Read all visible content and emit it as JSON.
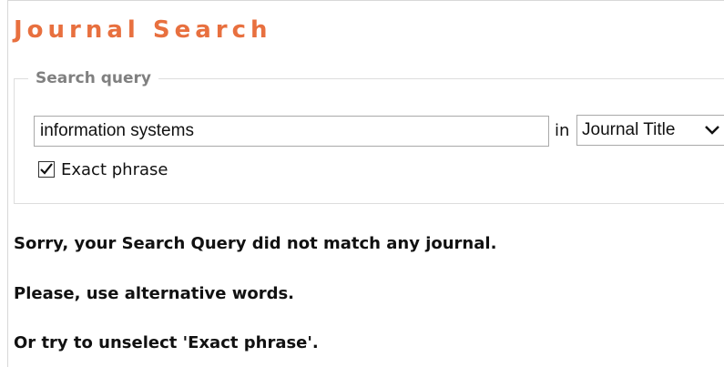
{
  "header": {
    "title": "Journal Search"
  },
  "search": {
    "legend": "Search query",
    "query_value": "information systems",
    "in_label": "in",
    "field_selected": "Journal Title",
    "exact_phrase_label": "Exact phrase",
    "exact_phrase_checked": true
  },
  "results": {
    "messages": [
      "Sorry, your Search Query did not match any journal.",
      "Please, use alternative words.",
      "Or try to unselect 'Exact phrase'."
    ]
  },
  "colors": {
    "title": "#e8703f",
    "legend": "#808080",
    "text": "#111111"
  },
  "icons": {
    "select_arrow": "chevron-down-icon",
    "checkbox_mark": "checkmark-icon"
  }
}
